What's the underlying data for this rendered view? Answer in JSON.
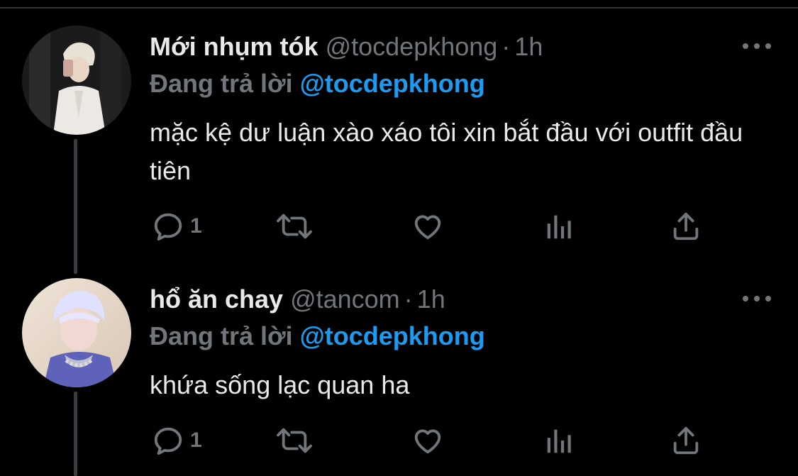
{
  "colors": {
    "background": "#000000",
    "text": "#e7e9ea",
    "muted": "#71767b",
    "link": "#1d9bf0",
    "thread_line": "#3a3d40"
  },
  "tweets": [
    {
      "name": "Mới nhụm tók",
      "handle": "@tocdepkhong",
      "dot": "·",
      "time": "1h",
      "reply_prefix": "Đang trả lời",
      "reply_handle": "@tocdepkhong",
      "text": "mặc kệ dư luận xào xáo tôi xin bắt đầu với outfit đầu tiên",
      "reply_count": "1",
      "icons": [
        "reply-icon",
        "retweet-icon",
        "like-icon",
        "views-icon",
        "share-icon",
        "more-icon"
      ]
    },
    {
      "name": "hổ ăn chay",
      "handle": "@tancom",
      "dot": "·",
      "time": "1h",
      "reply_prefix": "Đang trả lời",
      "reply_handle": "@tocdepkhong",
      "text": "khứa sống lạc quan ha",
      "reply_count": "1",
      "icons": [
        "reply-icon",
        "retweet-icon",
        "like-icon",
        "views-icon",
        "share-icon",
        "more-icon"
      ]
    }
  ]
}
